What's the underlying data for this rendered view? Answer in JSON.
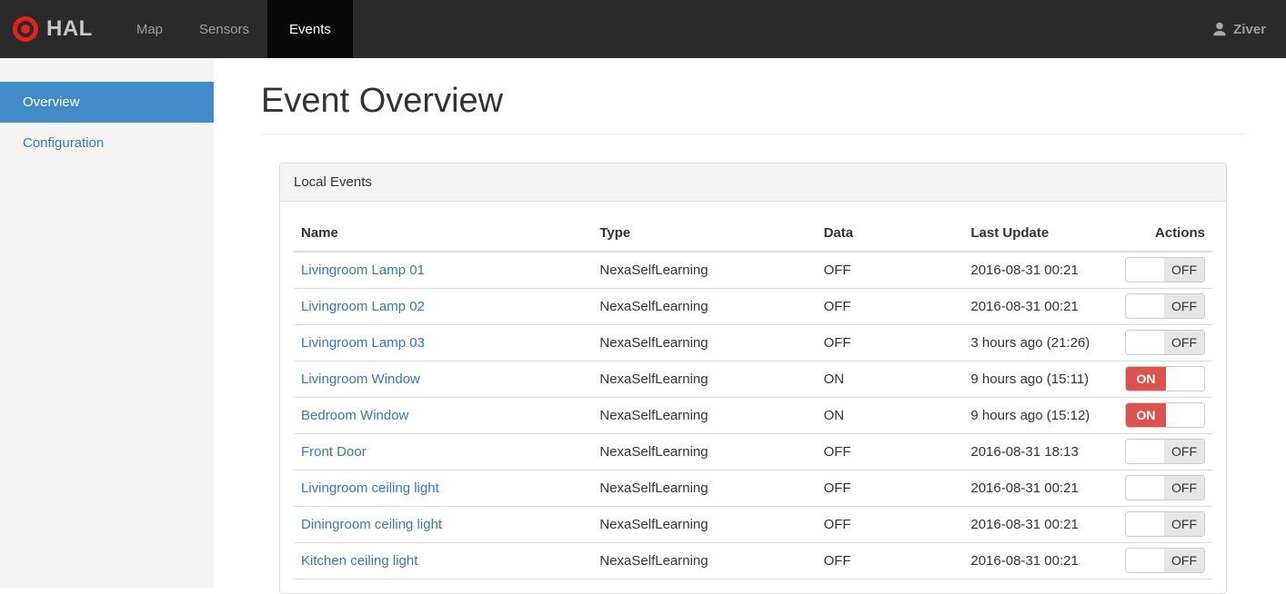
{
  "navbar": {
    "brand": "HAL",
    "items": [
      {
        "label": "Map",
        "active": false
      },
      {
        "label": "Sensors",
        "active": false
      },
      {
        "label": "Events",
        "active": true
      }
    ],
    "user": "Ziver"
  },
  "sidebar": {
    "items": [
      {
        "label": "Overview",
        "active": true
      },
      {
        "label": "Configuration",
        "active": false
      }
    ]
  },
  "main": {
    "title": "Event Overview",
    "panel": {
      "title": "Local Events",
      "table": {
        "columns": [
          "Name",
          "Type",
          "Data",
          "Last Update",
          "Actions"
        ],
        "rows": [
          {
            "name": "Livingroom Lamp 01",
            "type": "NexaSelfLearning",
            "data": "OFF",
            "last_update": "2016-08-31 00:21",
            "toggle": "OFF"
          },
          {
            "name": "Livingroom Lamp 02",
            "type": "NexaSelfLearning",
            "data": "OFF",
            "last_update": "2016-08-31 00:21",
            "toggle": "OFF"
          },
          {
            "name": "Livingroom Lamp 03",
            "type": "NexaSelfLearning",
            "data": "OFF",
            "last_update": "3 hours ago (21:26)",
            "toggle": "OFF"
          },
          {
            "name": "Livingroom Window",
            "type": "NexaSelfLearning",
            "data": "ON",
            "last_update": "9 hours ago (15:11)",
            "toggle": "ON"
          },
          {
            "name": "Bedroom Window",
            "type": "NexaSelfLearning",
            "data": "ON",
            "last_update": "9 hours ago (15:12)",
            "toggle": "ON"
          },
          {
            "name": "Front Door",
            "type": "NexaSelfLearning",
            "data": "OFF",
            "last_update": "2016-08-31 18:13",
            "toggle": "OFF"
          },
          {
            "name": "Livingroom ceiling light",
            "type": "NexaSelfLearning",
            "data": "OFF",
            "last_update": "2016-08-31 00:21",
            "toggle": "OFF"
          },
          {
            "name": "Diningroom ceiling light",
            "type": "NexaSelfLearning",
            "data": "OFF",
            "last_update": "2016-08-31 00:21",
            "toggle": "OFF"
          },
          {
            "name": "Kitchen ceiling light",
            "type": "NexaSelfLearning",
            "data": "OFF",
            "last_update": "2016-08-31 00:21",
            "toggle": "OFF"
          }
        ]
      }
    }
  },
  "colors": {
    "navbar_bg": "#2a2a2a",
    "navbar_active_bg": "#080808",
    "logo_red": "#e32119",
    "sidebar_bg": "#f4f4f4",
    "active_item_blue": "#428bca",
    "link_blue": "#337ab7",
    "toggle_on_red": "#d9534f",
    "toggle_off_gray": "#e6e6e6"
  }
}
